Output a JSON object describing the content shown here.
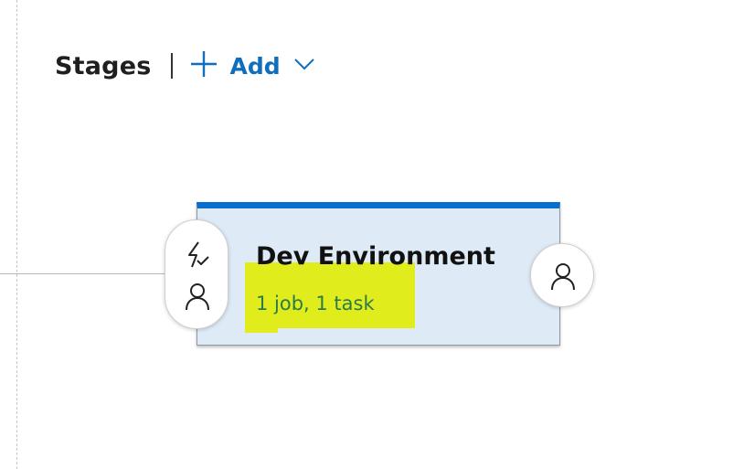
{
  "header": {
    "title": "Stages",
    "add_label": "Add",
    "icons": [
      "plus-icon",
      "chevron-down-icon"
    ]
  },
  "stage": {
    "name": "Dev Environment",
    "summary": "1 job, 1 task",
    "pre_conditions_icons": [
      "trigger-icon",
      "pre-deployment-approver-icon"
    ],
    "post_conditions_icons": [
      "post-deployment-approver-icon"
    ]
  },
  "colors": {
    "accent": "#106ebe",
    "stage_top_bar": "#0a6ecd",
    "stage_background": "#deebf7",
    "highlight": "#e1ec1d",
    "summary_text": "#2b7a4b"
  }
}
